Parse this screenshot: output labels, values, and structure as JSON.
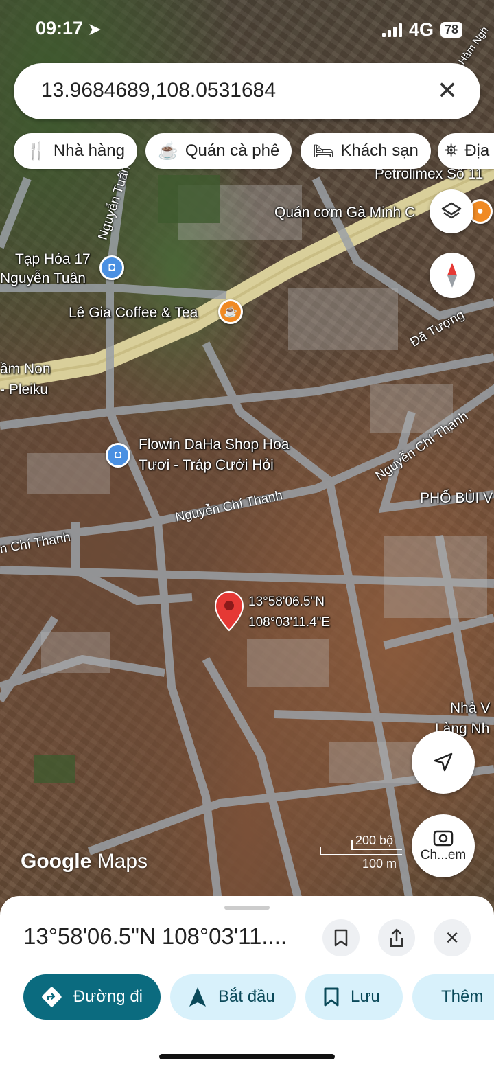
{
  "status_bar": {
    "time": "09:17",
    "network": "4G",
    "battery": "78"
  },
  "search": {
    "value": "13.9684689,108.0531684"
  },
  "chips": [
    {
      "label": "Nhà hàng",
      "icon": "fork-knife-icon"
    },
    {
      "label": "Quán cà phê",
      "icon": "coffee-cup-icon"
    },
    {
      "label": "Khách sạn",
      "icon": "bed-icon"
    },
    {
      "label": "Địa",
      "icon": "landmark-icon"
    }
  ],
  "map_labels": {
    "petrolimex": "Petrolimex Số 11",
    "quan_com": "Quán cơm Gà Minh C",
    "tap_hoa_1": "Tạp Hóa 17",
    "tap_hoa_2": "Nguyễn Tuân",
    "le_gia": "Lê Gia Coffee & Tea",
    "mam_non_1": "ầm Non",
    "mam_non_2": "- Pleiku",
    "flowin_1": "Flowin DaHa Shop Hoa",
    "flowin_2": "Tươi - Tráp Cưới Hỏi",
    "pho_bui": "PHỐ BÙI V",
    "nha_v_1": "Nhà V",
    "nha_v_2": "Làng Nh",
    "pin_lat": "13°58'06.5\"N",
    "pin_lng": "108°03'11.4\"E"
  },
  "road_labels": {
    "nguyen_tuan": "Nguyễn Tuân",
    "da_tuong": "Đã Tượng",
    "nct_1": "Nguyễn Chí Thanh",
    "nct_2": "Nguyễn Chí Thanh",
    "nct_3": "n Chí Thanh",
    "ham_nghi": "Hàm Ngh"
  },
  "map_controls": {
    "lens_label": "Ch...em"
  },
  "branding": {
    "google": "Google",
    "maps": "Maps"
  },
  "scale": {
    "feet": "200 bộ",
    "meters": "100 m"
  },
  "sheet": {
    "title": "13°58'06.5\"N 108°03'11....",
    "actions": [
      {
        "label": "Đường đi",
        "icon": "directions-icon"
      },
      {
        "label": "Bắt đầu",
        "icon": "navigation-arrow-icon"
      },
      {
        "label": "Lưu",
        "icon": "bookmark-icon"
      },
      {
        "label": "Thêm",
        "icon": "flag-icon"
      }
    ]
  },
  "colors": {
    "primary": "#0b6b7f",
    "secondary": "#d8f1fb",
    "pin": "#e53935",
    "cafe": "#f08a24",
    "shop": "#4a90e2"
  }
}
